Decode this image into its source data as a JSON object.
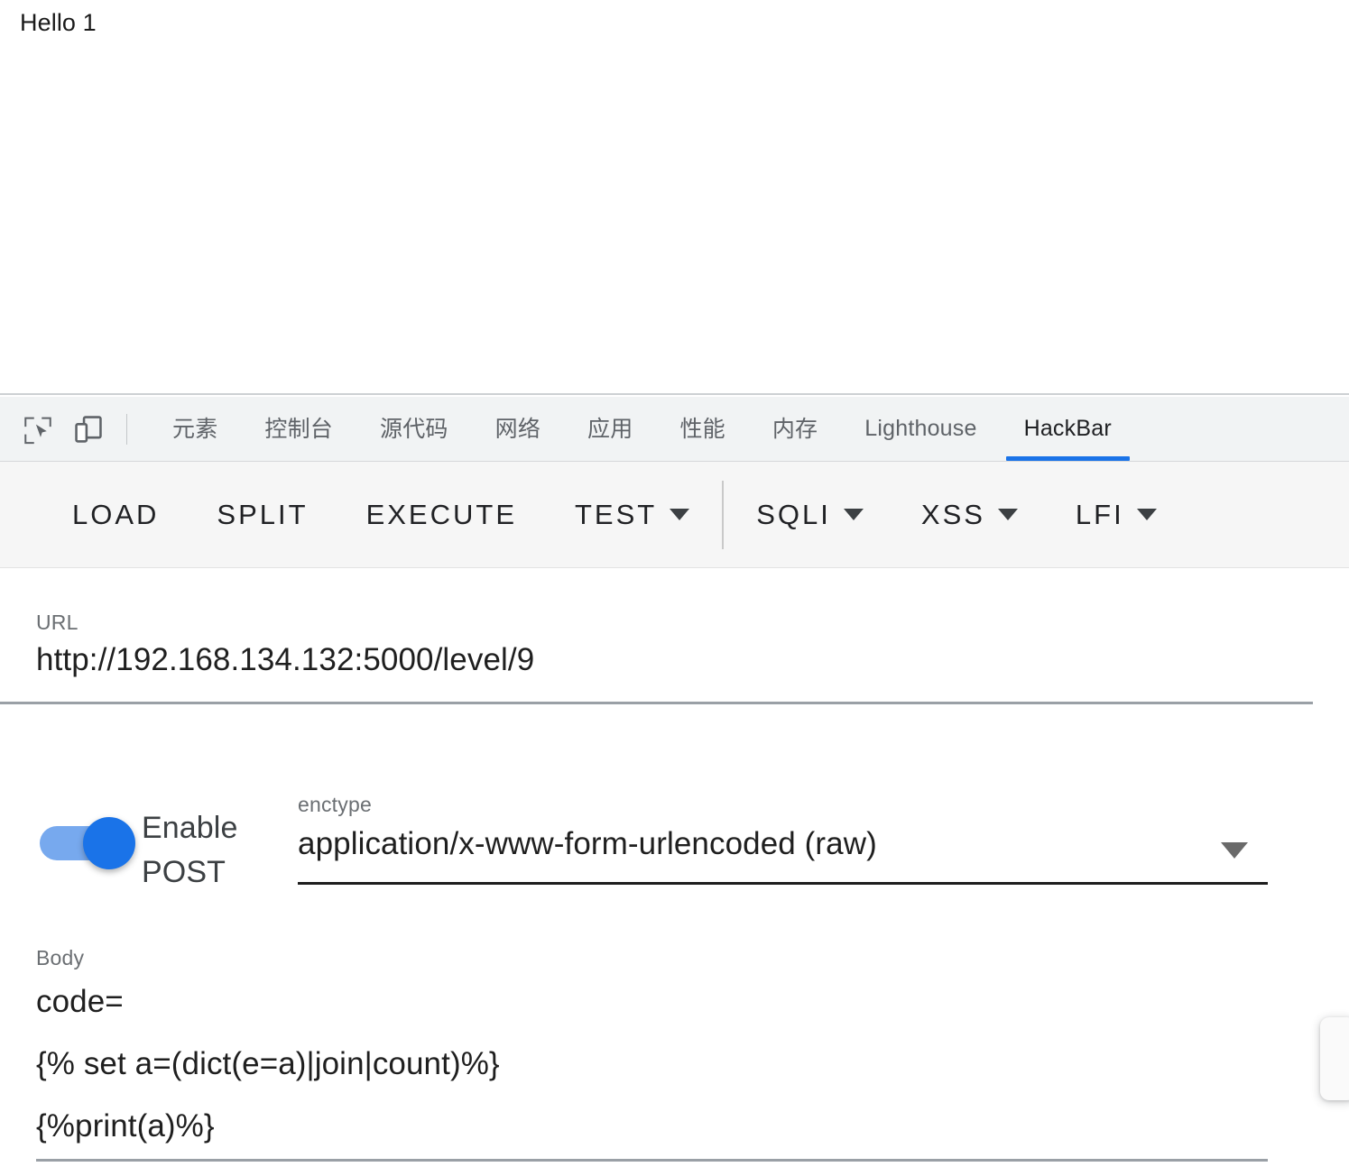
{
  "page": {
    "heading": "Hello 1"
  },
  "devtools": {
    "icons": [
      {
        "name": "inspect-element-icon",
        "label": "Inspect element"
      },
      {
        "name": "device-toolbar-icon",
        "label": "Toggle device toolbar"
      }
    ],
    "tabs": [
      {
        "label": "元素",
        "active": false,
        "cjk": true
      },
      {
        "label": "控制台",
        "active": false,
        "cjk": true
      },
      {
        "label": "源代码",
        "active": false,
        "cjk": true
      },
      {
        "label": "网络",
        "active": false,
        "cjk": true
      },
      {
        "label": "应用",
        "active": false,
        "cjk": true
      },
      {
        "label": "性能",
        "active": false,
        "cjk": true
      },
      {
        "label": "内存",
        "active": false,
        "cjk": true
      },
      {
        "label": "Lighthouse",
        "active": false,
        "cjk": false
      },
      {
        "label": "HackBar",
        "active": true,
        "cjk": false
      }
    ],
    "active_tab": "HackBar",
    "accent_color": "#1a73e8",
    "tabstrip_background": "#f1f3f4"
  },
  "hackbar": {
    "toolbar": {
      "background": "#f6f6f6",
      "buttons": [
        {
          "label": "LOAD",
          "has_caret": false
        },
        {
          "label": "SPLIT",
          "has_caret": false
        },
        {
          "label": "EXECUTE",
          "has_caret": false
        },
        {
          "label": "TEST",
          "has_caret": true
        },
        {
          "label": "SQLI",
          "has_caret": true
        },
        {
          "label": "XSS",
          "has_caret": true
        },
        {
          "label": "LFI",
          "has_caret": true
        }
      ]
    },
    "url": {
      "label": "URL",
      "value": "http://192.168.134.132:5000/level/9",
      "placeholder": "URL"
    },
    "post": {
      "toggle_label": "Enable POST",
      "toggle_on": true,
      "toggle_on_color": "#1a73e8",
      "toggle_track_color": "#77a9ee"
    },
    "enctype": {
      "label": "enctype",
      "value": "application/x-www-form-urlencoded (raw)"
    },
    "body": {
      "label": "Body",
      "lines": [
        "code=",
        "{% set a=(dict(e=a)|join|count)%}",
        "{%print(a)%}"
      ]
    }
  }
}
